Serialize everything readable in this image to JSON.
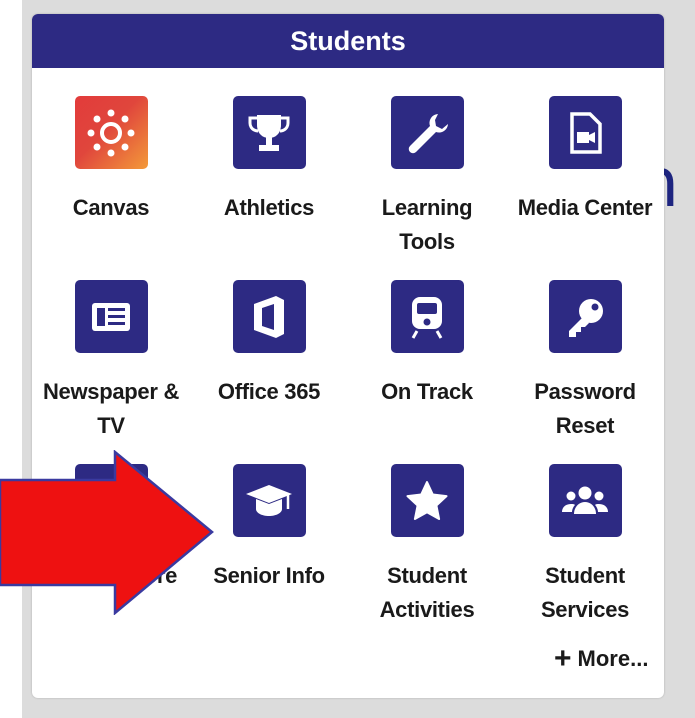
{
  "background": {
    "partial_text": "n"
  },
  "panel": {
    "title": "Students"
  },
  "tiles": [
    {
      "label": "Canvas",
      "icon": "canvas-logo-icon"
    },
    {
      "label": "Athletics",
      "icon": "trophy-icon"
    },
    {
      "label": "Learning\nTools",
      "icon": "wrench-icon"
    },
    {
      "label": "Media Center",
      "icon": "video-file-icon"
    },
    {
      "label": "Newspaper &\nTV",
      "icon": "newspaper-icon"
    },
    {
      "label": "Office 365",
      "icon": "office-icon"
    },
    {
      "label": "On Track",
      "icon": "train-icon"
    },
    {
      "label": "Password\nReset",
      "icon": "key-icon"
    },
    {
      "label": "School Store",
      "icon": "store-icon"
    },
    {
      "label": "Senior Info",
      "icon": "graduation-cap-icon"
    },
    {
      "label": "Student\nActivities",
      "icon": "star-icon"
    },
    {
      "label": "Student\nServices",
      "icon": "users-icon"
    }
  ],
  "more": {
    "label": "More..."
  },
  "colors": {
    "brand": "#2d2a83",
    "arrow": "#ee1111"
  }
}
